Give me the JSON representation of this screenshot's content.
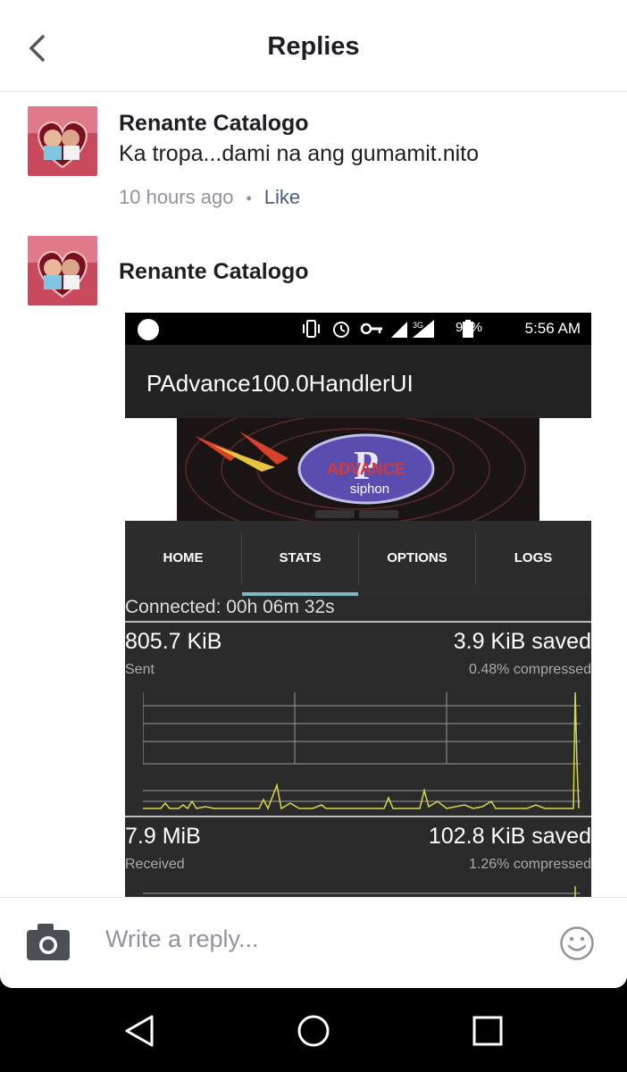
{
  "header": {
    "title": "Replies"
  },
  "replies": [
    {
      "author": "Renante Catalogo",
      "text": "Ka tropa...dami na ang gumamit.nito",
      "time": "10 hours ago",
      "separator": "•",
      "like": "Like"
    },
    {
      "author": "Renante Catalogo"
    }
  ],
  "attachment": {
    "status_bar": {
      "network": "3G",
      "battery": "98%",
      "time": "5:56 AM"
    },
    "app_title": "PAdvance100.0HandlerUI",
    "banner_text": [
      "ADVANCE",
      "siphon"
    ],
    "tabs": [
      "HOME",
      "STATS",
      "OPTIONS",
      "LOGS"
    ],
    "active_tab": "STATS",
    "connected": "Connected: 00h 06m 32s",
    "sent": {
      "amount": "805.7 KiB",
      "label": "Sent",
      "saved": "3.9 KiB saved",
      "compressed": "0.48% compressed"
    },
    "received": {
      "amount": "7.9 MiB",
      "label": "Received",
      "saved": "102.8 KiB saved",
      "compressed": "1.26% compressed"
    },
    "colors": {
      "graph_line": "#d8d84a",
      "tab_indicator": "#7fb7c5"
    }
  },
  "composer": {
    "placeholder": "Write a reply..."
  },
  "icons": [
    "back-arrow-icon",
    "camera-icon",
    "smiley-icon",
    "nav-back-icon",
    "nav-home-icon",
    "nav-recents-icon"
  ]
}
